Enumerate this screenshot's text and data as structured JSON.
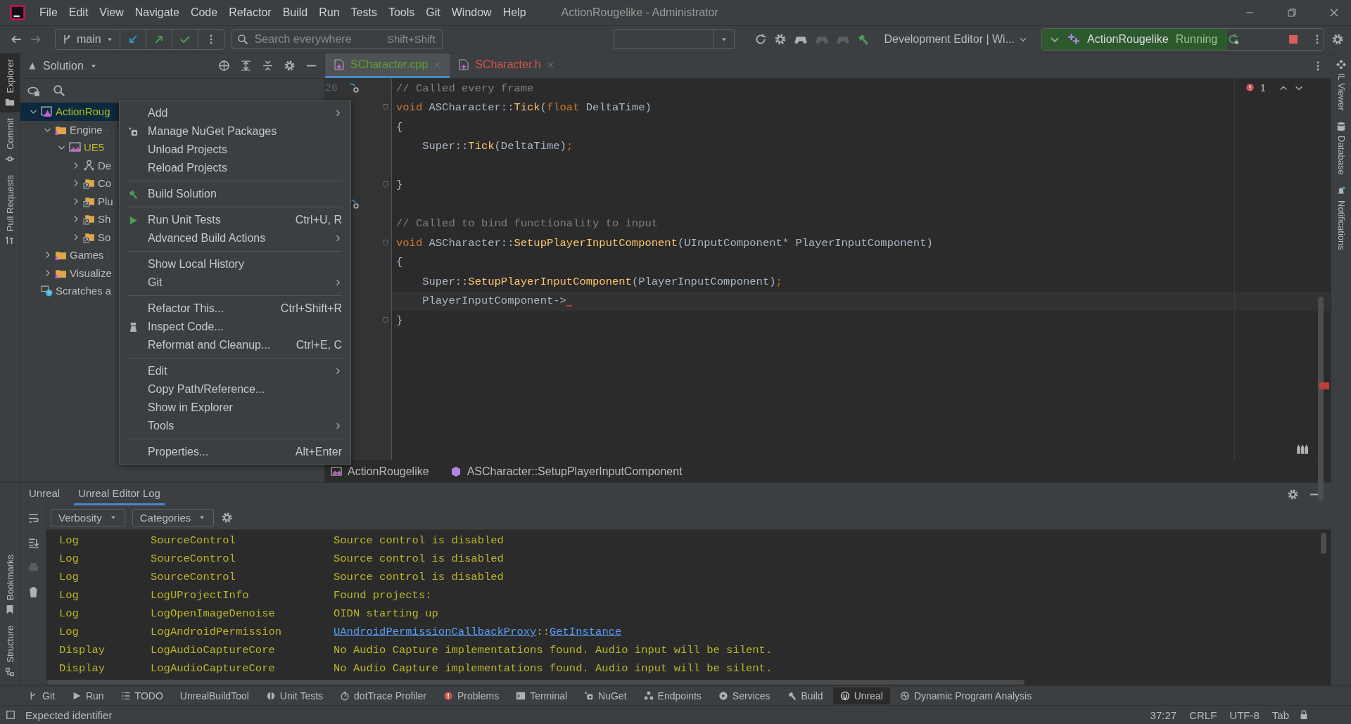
{
  "window": {
    "title": "ActionRougelike - Administrator"
  },
  "menu_bar": [
    "File",
    "Edit",
    "View",
    "Navigate",
    "Code",
    "Refactor",
    "Build",
    "Run",
    "Tests",
    "Tools",
    "Git",
    "Window",
    "Help"
  ],
  "toolbar": {
    "branch": "main",
    "search": {
      "placeholder": "Search everywhere",
      "shortcut": "Shift+Shift"
    },
    "configuration": "Development Editor | Wi...",
    "run_target": "ActionRougelike",
    "run_state": "Running"
  },
  "left_stripe": [
    {
      "label": "Explorer",
      "selected": true
    },
    {
      "label": "Commit",
      "selected": false
    },
    {
      "label": "Pull Requests",
      "selected": false
    }
  ],
  "left_stripe_bottom": [
    {
      "label": "Bookmarks",
      "selected": false
    },
    {
      "label": "Structure",
      "selected": false
    }
  ],
  "right_stripe": [
    "IL Viewer",
    "Database",
    "Notifications"
  ],
  "explorer": {
    "title": "Solution",
    "tree": [
      {
        "label": "ActionRoug",
        "kind": "project",
        "color": "#a8c023",
        "selected": true,
        "expanded": true,
        "children": [
          {
            "label": "Engine",
            "note": "·",
            "kind": "folder",
            "color": "#bbbbbb",
            "selected": false,
            "expanded": true,
            "children": [
              {
                "label": "UE5",
                "kind": "cpp",
                "color": "#b4b42c",
                "selected": false,
                "expanded": true,
                "children": [
                  {
                    "label": "De",
                    "kind": "graph",
                    "color": "#bbbbbb",
                    "selected": false,
                    "expanded": false
                  },
                  {
                    "label": "Co",
                    "kind": "link",
                    "color": "#bbbbbb",
                    "selected": false,
                    "expanded": false
                  },
                  {
                    "label": "Plu",
                    "kind": "link",
                    "color": "#bbbbbb",
                    "selected": false,
                    "expanded": false
                  },
                  {
                    "label": "Sh",
                    "kind": "link",
                    "color": "#bbbbbb",
                    "selected": false,
                    "expanded": false
                  },
                  {
                    "label": "So",
                    "kind": "link",
                    "color": "#bbbbbb",
                    "selected": false,
                    "expanded": false
                  }
                ]
              }
            ]
          },
          {
            "label": "Games",
            "note": "·",
            "kind": "folder",
            "color": "#bbbbbb",
            "selected": false,
            "expanded": false
          },
          {
            "label": "Visualize",
            "kind": "folder",
            "color": "#bbbbbb",
            "selected": false,
            "expanded": false
          }
        ]
      },
      {
        "label": "Scratches a",
        "kind": "scratches",
        "color": "#bbbbbb",
        "selected": false
      }
    ]
  },
  "tabs": [
    {
      "label": "SCharacter.cpp",
      "selected": true,
      "color": "#62a033"
    },
    {
      "label": "SCharacter.h",
      "selected": false,
      "color": "#d4544b"
    }
  ],
  "editor": {
    "line_number": "26",
    "error_count": "1",
    "lines": [
      {
        "fold": false,
        "tokens": [
          {
            "kind": "comment",
            "text": "// Called every frame"
          }
        ]
      },
      {
        "fold": true,
        "tokens": [
          {
            "kind": "keyword",
            "text": "void "
          },
          {
            "kind": "plain",
            "text": "ASCharacter::"
          },
          {
            "kind": "function",
            "text": "Tick"
          },
          {
            "kind": "plain",
            "text": "("
          },
          {
            "kind": "keyword",
            "text": "float "
          },
          {
            "kind": "plain",
            "text": "DeltaTime)"
          }
        ]
      },
      {
        "fold": false,
        "tokens": [
          {
            "kind": "plain",
            "text": "{"
          }
        ]
      },
      {
        "fold": false,
        "tokens": [
          {
            "kind": "plain",
            "text": "    Super::"
          },
          {
            "kind": "function",
            "text": "Tick"
          },
          {
            "kind": "plain",
            "text": "(DeltaTime)"
          },
          {
            "kind": "keyword",
            "text": ";"
          }
        ]
      },
      {
        "fold": false
      },
      {
        "fold": true,
        "tokens": [
          {
            "kind": "plain",
            "text": "}"
          }
        ]
      },
      {
        "fold": false
      },
      {
        "fold": false,
        "tokens": [
          {
            "kind": "comment",
            "text": "// Called to bind functionality to input"
          }
        ]
      },
      {
        "fold": true,
        "tokens": [
          {
            "kind": "keyword",
            "text": "void "
          },
          {
            "kind": "plain",
            "text": "ASCharacter::"
          },
          {
            "kind": "function",
            "text": "SetupPlayerInputComponent"
          },
          {
            "kind": "plain",
            "text": "(UInputComponent* PlayerInputComponent)"
          }
        ]
      },
      {
        "fold": false,
        "tokens": [
          {
            "kind": "plain",
            "text": "{"
          }
        ]
      },
      {
        "fold": false,
        "tokens": [
          {
            "kind": "plain",
            "text": "    Super::"
          },
          {
            "kind": "function",
            "text": "SetupPlayerInputComponent"
          },
          {
            "kind": "plain",
            "text": "(PlayerInputComponent)"
          },
          {
            "kind": "keyword",
            "text": ";"
          }
        ]
      },
      {
        "fold": false,
        "current": true,
        "tokens": [
          {
            "kind": "plain",
            "text": "    PlayerInputComponent->"
          }
        ]
      },
      {
        "fold": true,
        "tokens": [
          {
            "kind": "plain",
            "text": "}"
          }
        ]
      }
    ]
  },
  "breadcrumb": [
    "ActionRougelike",
    "ASCharacter::SetupPlayerInputComponent"
  ],
  "context_menu": [
    [
      {
        "label": "Add",
        "kind": "plain",
        "submenu": true
      },
      {
        "label": "Manage NuGet Packages",
        "kind": "nuget",
        "submenu": false
      },
      {
        "label": "Unload Projects",
        "kind": "plain",
        "submenu": false
      },
      {
        "label": "Reload Projects",
        "kind": "plain",
        "submenu": false
      }
    ],
    [
      {
        "label": "Build Solution",
        "kind": "build",
        "submenu": false
      }
    ],
    [
      {
        "label": "Run Unit Tests",
        "kind": "run",
        "shortcut": "Ctrl+U, R",
        "submenu": false
      },
      {
        "label": "Advanced Build Actions",
        "kind": "plain",
        "submenu": true
      }
    ],
    [
      {
        "label": "Show Local History",
        "kind": "plain",
        "submenu": false
      },
      {
        "label": "Git",
        "kind": "plain",
        "submenu": true
      }
    ],
    [
      {
        "label": "Refactor This...",
        "kind": "plain",
        "shortcut": "Ctrl+Shift+R",
        "submenu": false
      },
      {
        "label": "Inspect Code...",
        "kind": "inspect",
        "submenu": false
      },
      {
        "label": "Reformat and Cleanup...",
        "kind": "plain",
        "shortcut": "Ctrl+E, C",
        "submenu": false
      }
    ],
    [
      {
        "label": "Edit",
        "kind": "plain",
        "submenu": true
      },
      {
        "label": "Copy Path/Reference...",
        "kind": "plain",
        "submenu": false
      },
      {
        "label": "Show in Explorer",
        "kind": "plain",
        "submenu": false
      },
      {
        "label": "Tools",
        "kind": "plain",
        "submenu": true
      }
    ],
    [
      {
        "label": "Properties...",
        "kind": "plain",
        "shortcut": "Alt+Enter",
        "submenu": false
      }
    ]
  ],
  "bottom_panel": {
    "tabs": [
      {
        "label": "Unreal",
        "selected": false
      },
      {
        "label": "Unreal Editor Log",
        "selected": true
      }
    ],
    "filters": [
      "Verbosity",
      "Categories"
    ],
    "log": [
      {
        "verbosity": "Log",
        "category": "SourceControl",
        "message": [
          {
            "text": "Source control is disabled",
            "link": false
          }
        ]
      },
      {
        "verbosity": "Log",
        "category": "SourceControl",
        "message": [
          {
            "text": "Source control is disabled",
            "link": false
          }
        ]
      },
      {
        "verbosity": "Log",
        "category": "SourceControl",
        "message": [
          {
            "text": "Source control is disabled",
            "link": false
          }
        ]
      },
      {
        "verbosity": "Log",
        "category": "LogUProjectInfo",
        "message": [
          {
            "text": "Found projects:",
            "link": false
          }
        ]
      },
      {
        "verbosity": "Log",
        "category": "LogOpenImageDenoise",
        "message": [
          {
            "text": "OIDN starting up",
            "link": false
          }
        ]
      },
      {
        "verbosity": "Log",
        "category": "LogAndroidPermission",
        "message": [
          {
            "text": "UAndroidPermissionCallbackProxy",
            "link": true
          },
          {
            "text": "::",
            "link": false
          },
          {
            "text": "GetInstance",
            "link": true
          }
        ]
      },
      {
        "verbosity": "Display",
        "category": "LogAudioCaptureCore",
        "message": [
          {
            "text": "No Audio Capture implementations found. Audio input will be silent.",
            "link": false
          }
        ]
      },
      {
        "verbosity": "Display",
        "category": "LogAudioCaptureCore",
        "message": [
          {
            "text": "No Audio Capture implementations found. Audio input will be silent.",
            "link": false
          }
        ]
      }
    ]
  },
  "tool_windows": [
    {
      "label": "Git",
      "kind": "git",
      "selected": false
    },
    {
      "label": "Run",
      "kind": "run",
      "selected": false
    },
    {
      "label": "TODO",
      "kind": "list",
      "selected": false
    },
    {
      "label": "UnrealBuildTool",
      "kind": "none",
      "selected": false
    },
    {
      "label": "Unit Tests",
      "kind": "tests",
      "selected": false
    },
    {
      "label": "dotTrace Profiler",
      "kind": "profiler",
      "selected": false
    },
    {
      "label": "Problems",
      "kind": "problems",
      "selected": false
    },
    {
      "label": "Terminal",
      "kind": "terminal",
      "selected": false
    },
    {
      "label": "NuGet",
      "kind": "nuget",
      "selected": false
    },
    {
      "label": "Endpoints",
      "kind": "endpoints",
      "selected": false
    },
    {
      "label": "Services",
      "kind": "services",
      "selected": false
    },
    {
      "label": "Build",
      "kind": "build",
      "selected": false
    },
    {
      "label": "Unreal",
      "kind": "unreal",
      "selected": true
    },
    {
      "label": "Dynamic Program Analysis",
      "kind": "dpa",
      "selected": false
    }
  ],
  "status_bar": {
    "message": "Expected identifier",
    "items": [
      "37:27",
      "CRLF",
      "UTF-8",
      "Tab"
    ]
  }
}
